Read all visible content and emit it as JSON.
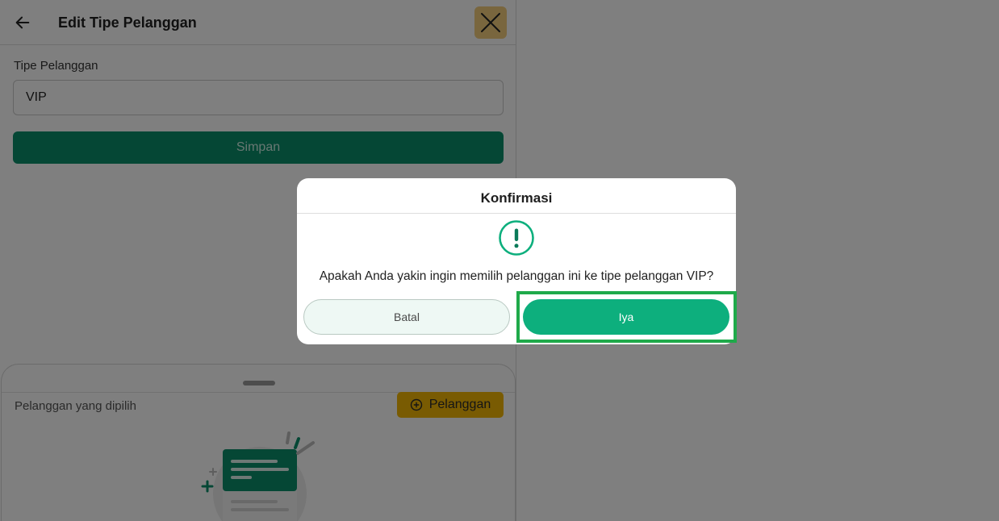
{
  "appbar": {
    "title": "Edit Tipe Pelanggan"
  },
  "form": {
    "field_label": "Tipe Pelanggan",
    "field_value": "VIP",
    "save_label": "Simpan"
  },
  "sheet": {
    "label": "Pelanggan yang dipilih",
    "add_button_label": "Pelanggan"
  },
  "dialog": {
    "title": "Konfirmasi",
    "message": "Apakah Anda yakin ingin memilih pelanggan ini ke tipe pelanggan VIP?",
    "cancel_label": "Batal",
    "confirm_label": "Iya"
  },
  "colors": {
    "primary_green": "#0daf7d",
    "dark_green": "#0a8f6a",
    "accent_yellow": "#f2b705",
    "highlight_border": "#1faa4a"
  },
  "icons": {
    "back": "arrow-left-icon",
    "close": "close-icon",
    "alert": "exclamation-circle-icon",
    "add": "plus-circle-icon"
  }
}
